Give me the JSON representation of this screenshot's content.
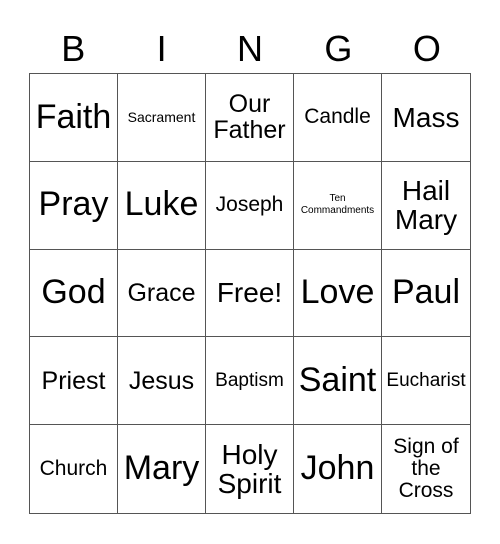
{
  "header": [
    "B",
    "I",
    "N",
    "G",
    "O"
  ],
  "cells": [
    [
      "Faith",
      "Sacrament",
      "Our Father",
      "Candle",
      "Mass"
    ],
    [
      "Pray",
      "Luke",
      "Joseph",
      "Ten Commandments",
      "Hail Mary"
    ],
    [
      "God",
      "Grace",
      "Free!",
      "Love",
      "Paul"
    ],
    [
      "Priest",
      "Jesus",
      "Baptism",
      "Saint",
      "Eucharist"
    ],
    [
      "Church",
      "Mary",
      "Holy Spirit",
      "John",
      "Sign of the Cross"
    ]
  ]
}
